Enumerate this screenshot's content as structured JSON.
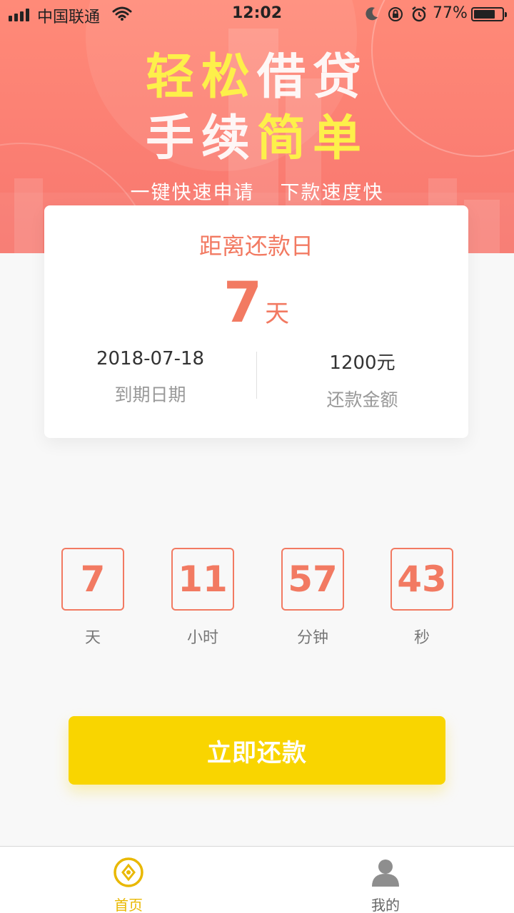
{
  "status_bar": {
    "carrier": "中国联通",
    "time": "12:02",
    "battery_percent": "77%",
    "battery_level": 0.77
  },
  "hero": {
    "slogan_line1": [
      "轻松",
      "借贷"
    ],
    "slogan_line2": [
      "手续",
      "简单"
    ],
    "subslogan": [
      "一键快速申请",
      "下款速度快"
    ]
  },
  "card": {
    "title": "距离还款日",
    "days_value": "7",
    "days_unit": "天",
    "due_date_value": "2018-07-18",
    "due_date_label": "到期日期",
    "amount_value": "1200元",
    "amount_label": "还款金额"
  },
  "countdown": [
    {
      "value": "7",
      "label": "天"
    },
    {
      "value": "11",
      "label": "小时"
    },
    {
      "value": "57",
      "label": "分钟"
    },
    {
      "value": "43",
      "label": "秒"
    }
  ],
  "repay_button": "立即还款",
  "tab_bar": [
    {
      "label": "首页",
      "icon": "home-coin-icon",
      "active": true
    },
    {
      "label": "我的",
      "icon": "user-icon",
      "active": false
    }
  ],
  "colors": {
    "accent": "#f27a62",
    "button": "#f9d500",
    "tab_active": "#e9b800",
    "hero": "#fb7f73"
  }
}
